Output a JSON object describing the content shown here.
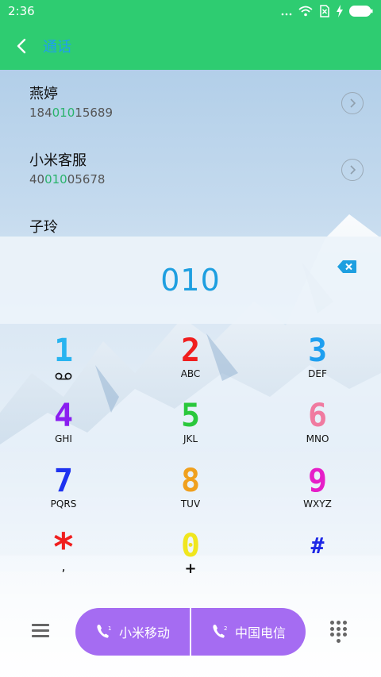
{
  "status_bar": {
    "time": "2:36"
  },
  "header": {
    "title": "通话"
  },
  "contacts": [
    {
      "name": "燕婷",
      "number_pre": "184",
      "number_match": "010",
      "number_post": "15689"
    },
    {
      "name": "小米客服",
      "number_pre": "40",
      "number_match": "010",
      "number_post": "05678"
    },
    {
      "name": "子玲"
    }
  ],
  "dialer": {
    "input": "010"
  },
  "keypad": [
    {
      "digit": "1",
      "letters": "",
      "color": "#28b4f0"
    },
    {
      "digit": "2",
      "letters": "ABC",
      "color": "#f01e1e"
    },
    {
      "digit": "3",
      "letters": "DEF",
      "color": "#1e9ff0"
    },
    {
      "digit": "4",
      "letters": "GHI",
      "color": "#8a1ef0"
    },
    {
      "digit": "5",
      "letters": "JKL",
      "color": "#2ac83c"
    },
    {
      "digit": "6",
      "letters": "MNO",
      "color": "#f07aa0"
    },
    {
      "digit": "7",
      "letters": "PQRS",
      "color": "#1e32f0"
    },
    {
      "digit": "8",
      "letters": "TUV",
      "color": "#f0a01e"
    },
    {
      "digit": "9",
      "letters": "WXYZ",
      "color": "#e61ec8"
    },
    {
      "digit": "*",
      "letters": ",",
      "color": "#f01e1e"
    },
    {
      "digit": "0",
      "letters": "+",
      "color": "#f0e61e"
    },
    {
      "digit": "#",
      "letters": "",
      "color": "#1e28e6"
    }
  ],
  "bottom_bar": {
    "sim1_label": "小米移动",
    "sim1_index": "1",
    "sim2_label": "中国电信",
    "sim2_index": "2"
  },
  "icons": {
    "back": "chevron-left-icon",
    "info": "chevron-right-circle-icon",
    "delete": "backspace-icon",
    "voicemail": "voicemail-icon",
    "menu": "hamburger-icon",
    "dialpad": "dialpad-icon",
    "phone": "phone-icon",
    "signal": "signal-icon",
    "wifi": "wifi-icon",
    "no_sim": "no-sim-icon",
    "charging": "charging-icon",
    "battery": "battery-icon"
  },
  "colors": {
    "header_bg": "#2ecc71",
    "title": "#1f9ef0",
    "accent_call": "#a56cf2",
    "match": "#2ab36b",
    "digits": "#1e9fe0"
  }
}
